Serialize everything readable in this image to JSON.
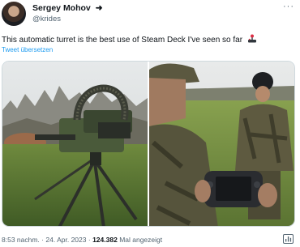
{
  "author": {
    "display_name": "Sergey Mohov",
    "handle": "@krides",
    "name_suffix_glyph": "➜"
  },
  "header": {
    "more_glyph": "···"
  },
  "tweet": {
    "text": "This automatic turret is the best use of Steam Deck I've seen so far",
    "translate_label": "Tweet übersetzen"
  },
  "media": {
    "icons": [
      "turret-photo",
      "soldiers-steam-deck-photo"
    ]
  },
  "meta": {
    "time": "8:53 nachm.",
    "separator": "·",
    "date": "24. Apr. 2023",
    "views_count": "124.382",
    "views_label": "Mal angezeigt"
  },
  "colors": {
    "link": "#1d9bf0",
    "secondary_text": "#536471",
    "primary_text": "#0f1419"
  }
}
